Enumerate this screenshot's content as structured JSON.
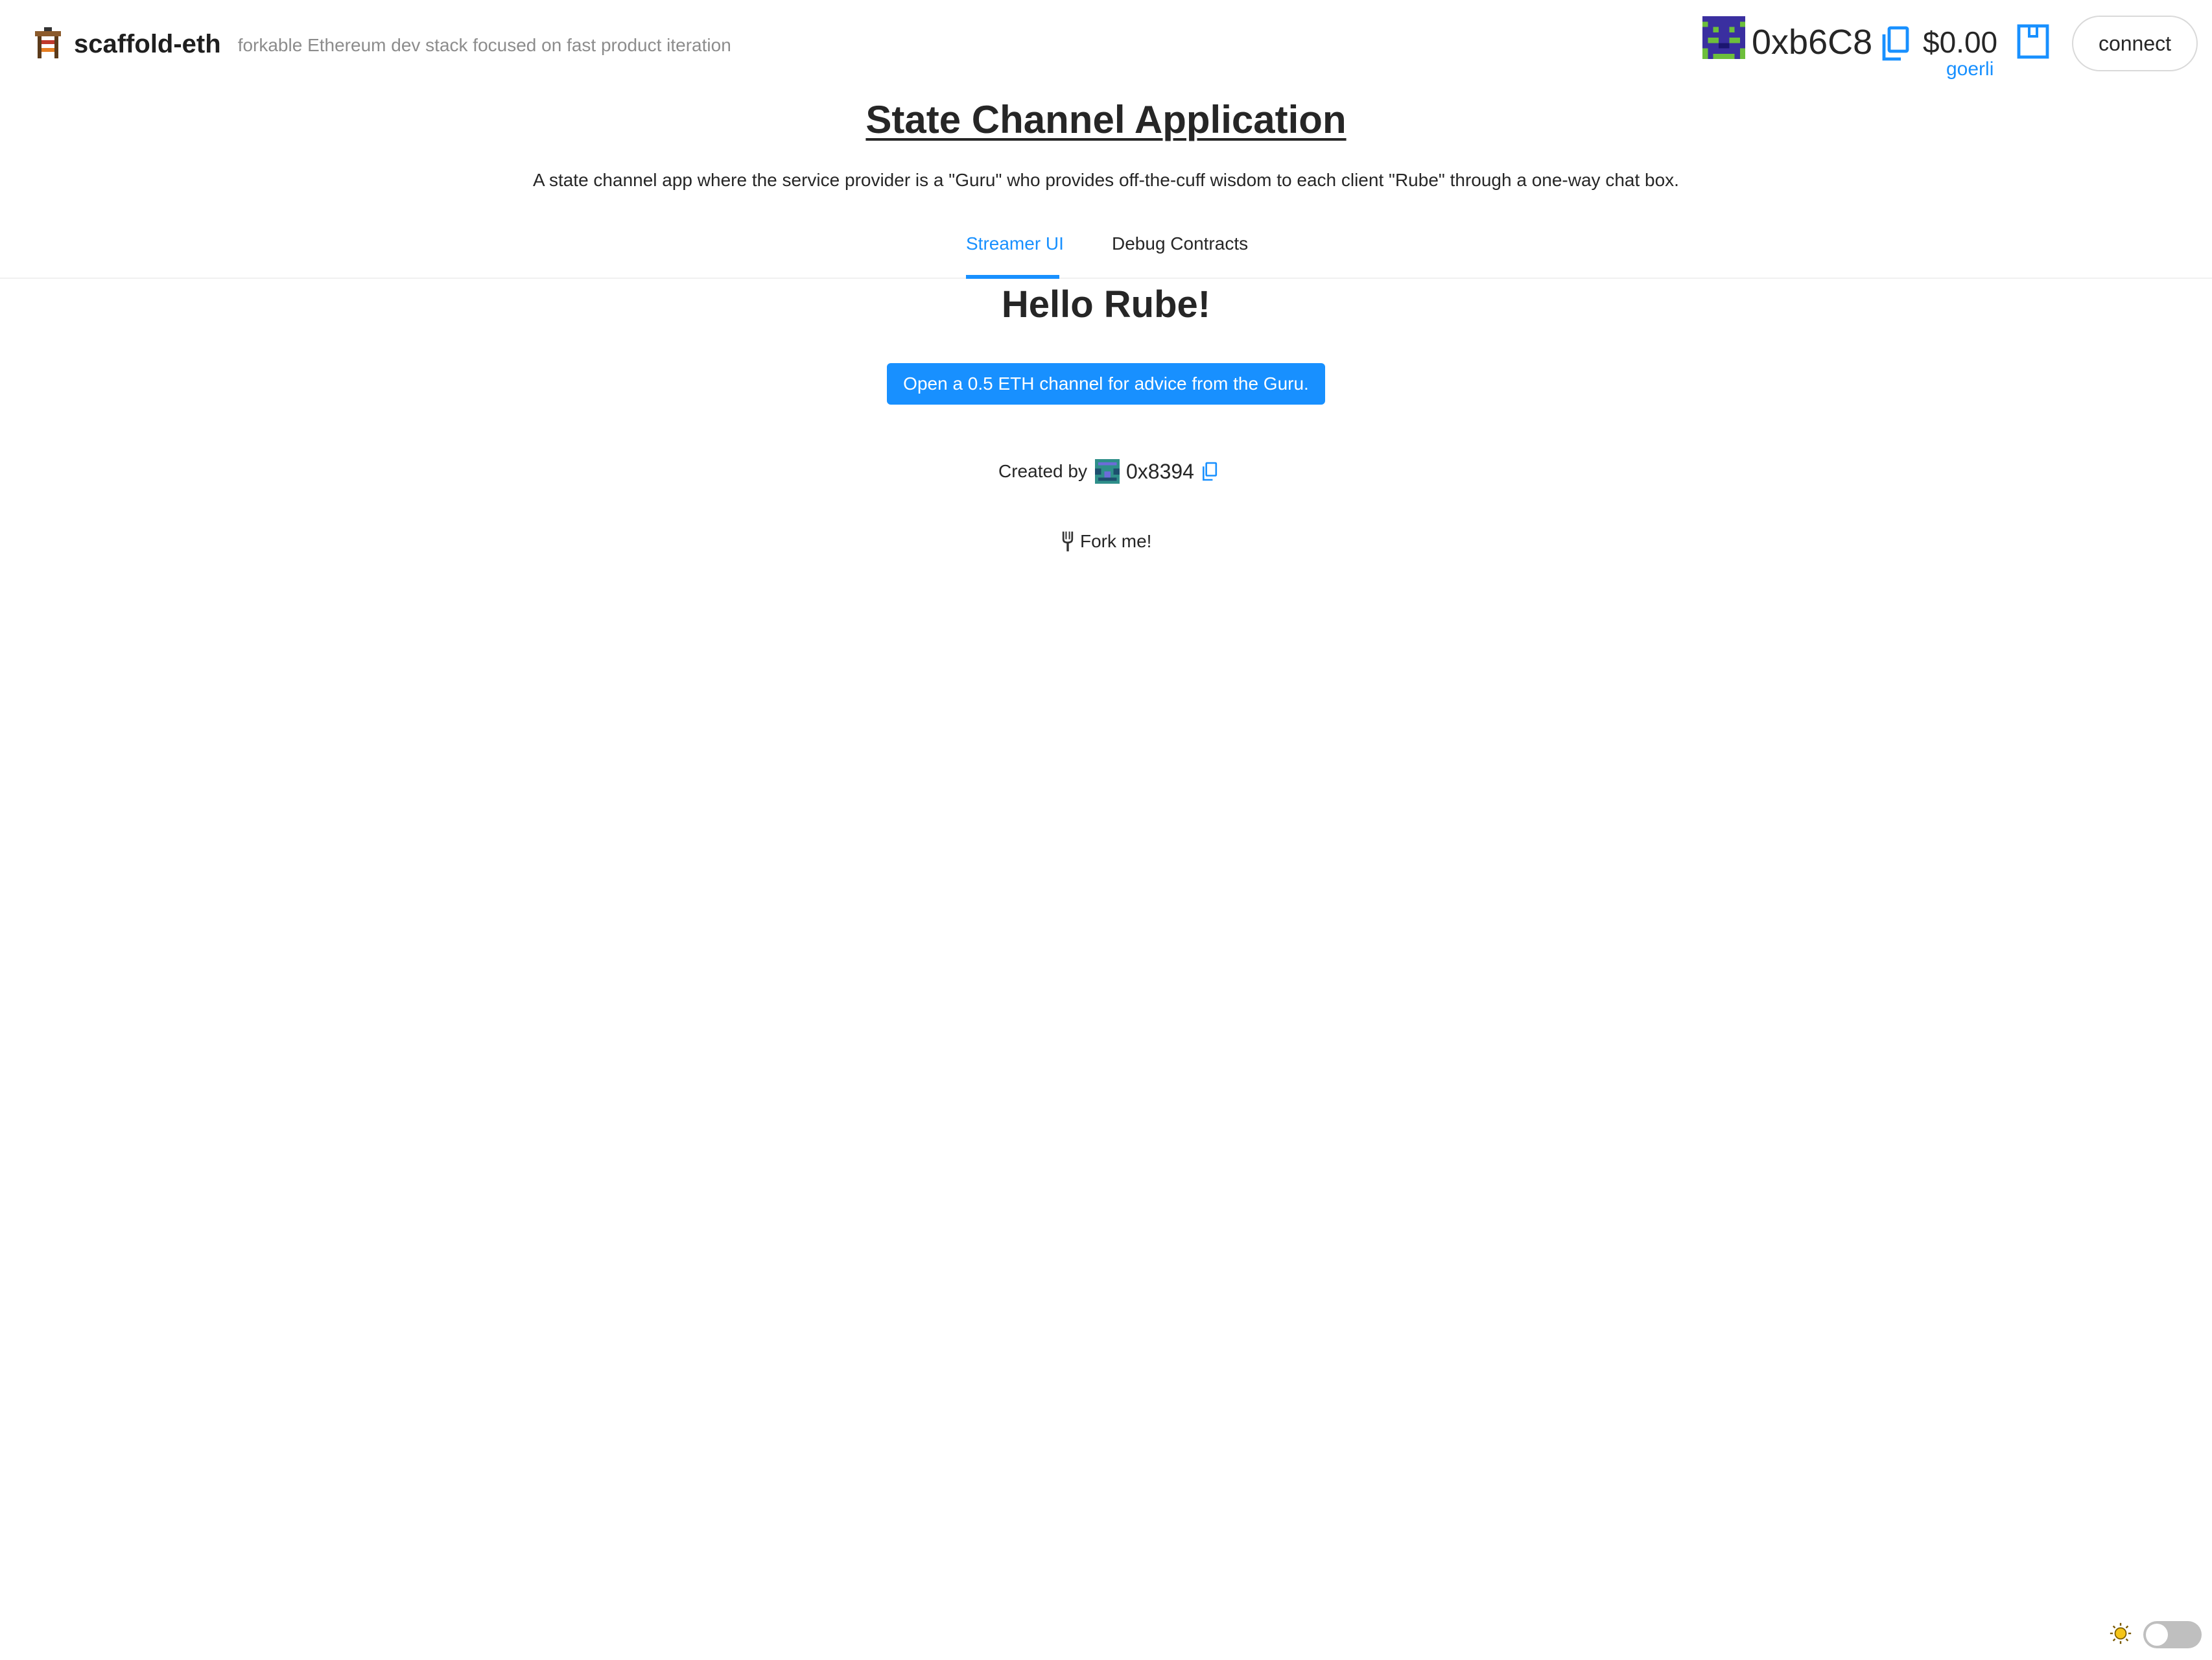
{
  "header": {
    "brand_title": "scaffold-eth",
    "brand_subtitle": "forkable Ethereum dev stack focused on fast product iteration",
    "brand_icon": "scaffold-emoji-icon",
    "account": {
      "address": "0xb6C8",
      "balance": "$0.00",
      "network": "goerli",
      "connect_label": "connect"
    }
  },
  "main": {
    "title": "State Channel Application",
    "subtitle": "A state channel app where the service provider is a \"Guru\" who provides off-the-cuff wisdom to each client \"Rube\" through a one-way chat box.",
    "tabs": [
      {
        "label": "Streamer UI",
        "active": true
      },
      {
        "label": "Debug Contracts",
        "active": false
      }
    ],
    "greeting": "Hello Rube!",
    "open_channel_label": "Open a 0.5 ETH channel for advice from the Guru.",
    "created_by_label": "Created by",
    "creator_address": "0x8394",
    "fork_label": "Fork me!"
  },
  "colors": {
    "accent": "#1890ff",
    "text": "#262626",
    "muted": "#8c8c8c"
  },
  "footer": {
    "theme_icon": "sun-icon",
    "theme_toggle_on": false
  }
}
